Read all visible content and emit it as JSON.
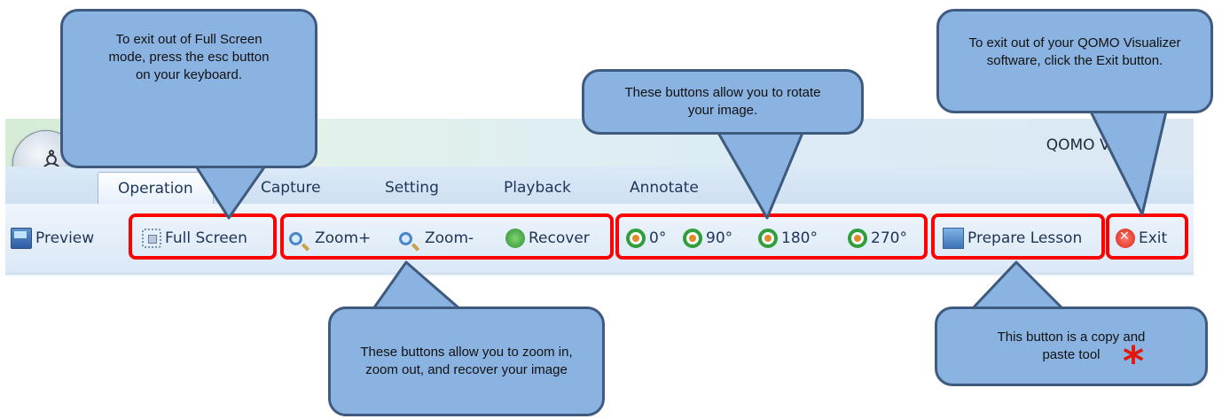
{
  "window": {
    "title": "QOMO Visua"
  },
  "ribbon": {
    "tabs": [
      "Operation",
      "Capture",
      "Setting",
      "Playback",
      "Annotate"
    ]
  },
  "toolbar": {
    "preview": "Preview",
    "full_screen": "Full Screen",
    "zoom_in": "Zoom+",
    "zoom_out": "Zoom-",
    "recover": "Recover",
    "rot_0": "0°",
    "rot_90": "90°",
    "rot_180": "180°",
    "rot_270": "270°",
    "prepare_lesson": "Prepare Lesson",
    "exit": "Exit"
  },
  "callouts": {
    "full_screen": "To exit out of Full Screen mode, press the esc button on your keyboard.",
    "rotate": "These buttons allow you to rotate your image.",
    "exit": "To exit out of your QOMO Visualizer software, click the Exit button.",
    "zoom": "These buttons allow you to zoom in, zoom out, and recover your image",
    "lesson": "This button is a copy and paste tool",
    "lesson_mark": "*"
  },
  "colors": {
    "highlight": "#ff0000",
    "callout_fill": "#8ab3e1",
    "callout_border": "#3e5a7e",
    "mark": "#e3170a"
  }
}
